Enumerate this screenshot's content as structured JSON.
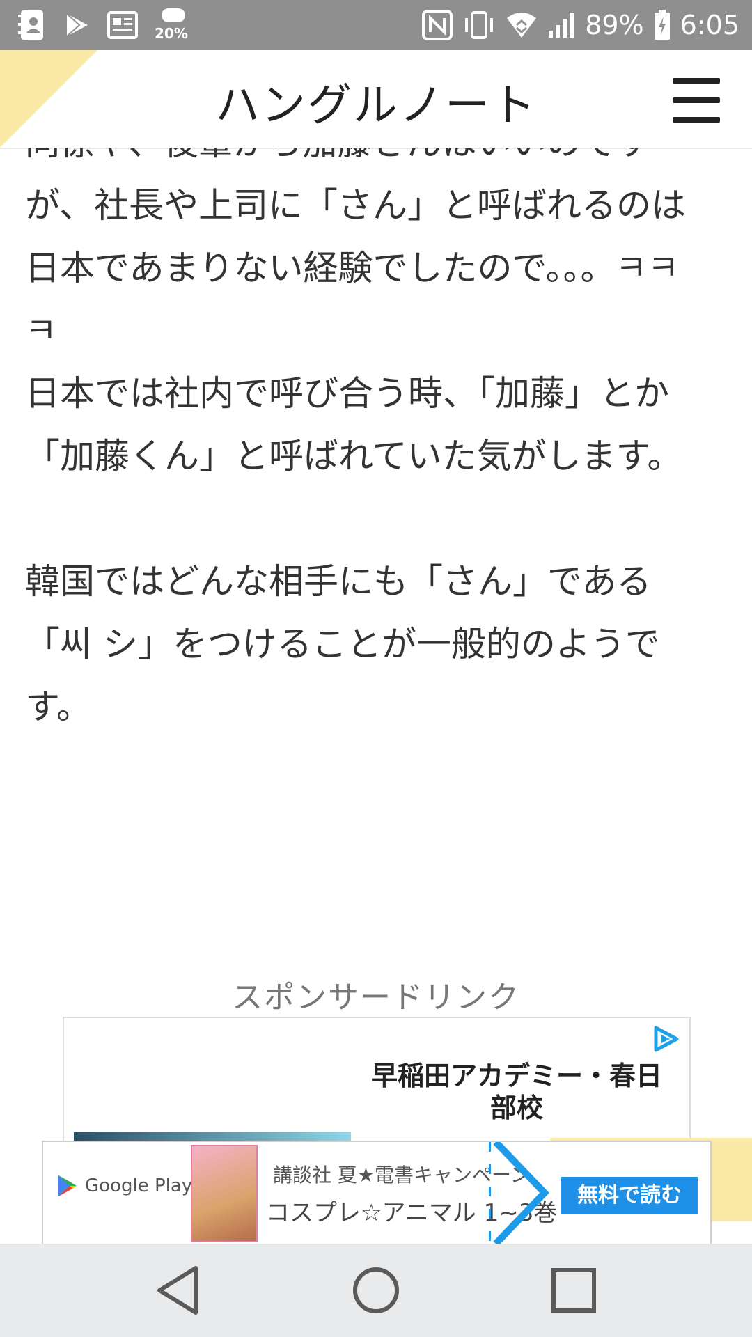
{
  "status_bar": {
    "weather_percent": "20%",
    "battery": "89%",
    "time": "6:05",
    "icons": [
      "contacts-icon",
      "play-store-icon",
      "news-icon",
      "weather-icon",
      "nfc-icon",
      "vibrate-icon",
      "wifi-icon",
      "signal-icon",
      "battery-icon"
    ]
  },
  "header": {
    "title": "ハングルノート",
    "menu_icon": "hamburger-menu-icon"
  },
  "article": {
    "paragraphs": [
      "同僚や、後輩から加藤さんはいいのですが、社長や上司に「さん」と呼ばれるのは日本であまりない経験でしたので。。。ㅋㅋㅋ",
      "日本では社内で呼び合う時、「加藤」とか「加藤くん」と呼ばれていた気がします。",
      "韓国ではどんな相手にも「さん」である「씨 シ」をつけることが一般的のようです。"
    ]
  },
  "sponsor": {
    "label": "スポンサードリンク"
  },
  "ad_card": {
    "title": "早稲田アカデミー・春日部校",
    "choice_icon": "adchoices-icon"
  },
  "banner": {
    "store": "Google Play",
    "line1": "講談社 夏★電書キャンペーン",
    "line2": "コスプレ☆アニマル 1~3巻",
    "cta": "無料で読む"
  },
  "nav_bar": {
    "icons": [
      "back-icon",
      "home-icon",
      "recents-icon"
    ]
  },
  "colors": {
    "status_bar": "#8f8f8f",
    "accent_yellow": "#fbe9a8",
    "cta_blue": "#1e90e8",
    "nav_bar": "#e9eaec"
  }
}
